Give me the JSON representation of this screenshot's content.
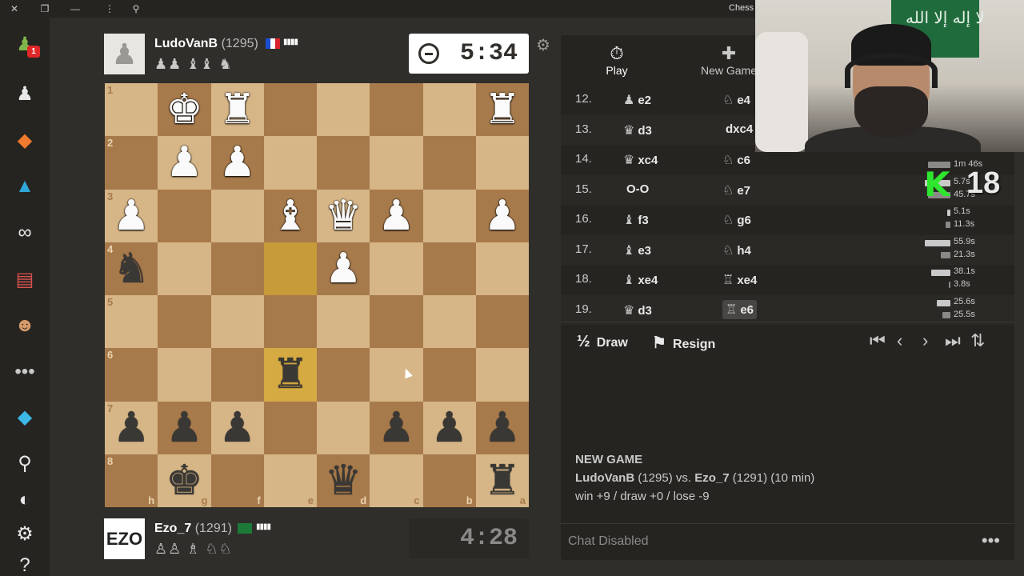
{
  "window": {
    "title": "Chess -"
  },
  "sidebar": {
    "notification_count": "1"
  },
  "top_player": {
    "name": "LudoVanB",
    "rating": "(1295)",
    "captured": "♟♟ ♝♝ ♞",
    "clock": "5:34"
  },
  "bottom_player": {
    "name": "Ezo_7",
    "rating": "(1291)",
    "avatar_text": "EZO",
    "captured": "♙♙ ♗ ♘♘",
    "clock": "4:28"
  },
  "board": {
    "rank_labels": [
      "1",
      "2",
      "3",
      "4",
      "5",
      "6",
      "7",
      "8"
    ],
    "file_labels": [
      "h",
      "g",
      "f",
      "e",
      "d",
      "c",
      "b",
      "a"
    ],
    "rows": [
      [
        "",
        "wK",
        "wR",
        "",
        "",
        "",
        "",
        "wR"
      ],
      [
        "",
        "wP",
        "wP",
        "",
        "",
        "",
        "",
        ""
      ],
      [
        "wP",
        "",
        "",
        "wB",
        "wQ",
        "wP",
        "",
        "wP"
      ],
      [
        "bN",
        "",
        "",
        "",
        "wP",
        "",
        "",
        ""
      ],
      [
        "",
        "",
        "",
        "",
        "",
        "",
        "",
        ""
      ],
      [
        "",
        "",
        "",
        "bR",
        "",
        "",
        "",
        ""
      ],
      [
        "bP",
        "bP",
        "bP",
        "",
        "",
        "bP",
        "bP",
        "bP"
      ],
      [
        "",
        "bK",
        "",
        "",
        "bQ",
        "",
        "",
        "bR"
      ]
    ]
  },
  "tabs": {
    "play": "Play",
    "new_game": "New Game"
  },
  "moves": [
    {
      "n": "12.",
      "wp": "♟",
      "w": "e2",
      "bp": "♘",
      "b": "e4",
      "wt": "",
      "bt": ""
    },
    {
      "n": "13.",
      "wp": "♛",
      "w": "d3",
      "bp": "",
      "b": "dxc4",
      "wt": "",
      "bt": ""
    },
    {
      "n": "14.",
      "wp": "♛",
      "w": "xc4",
      "bp": "♘",
      "b": "c6",
      "wt": "",
      "bt": "1m 46s"
    },
    {
      "n": "15.",
      "wp": "",
      "w": "O-O",
      "bp": "♘",
      "b": "e7",
      "wt": "5.7s",
      "bt": "45.7s"
    },
    {
      "n": "16.",
      "wp": "♝",
      "w": "f3",
      "bp": "♘",
      "b": "g6",
      "wt": "5.1s",
      "bt": "11.3s"
    },
    {
      "n": "17.",
      "wp": "♝",
      "w": "e3",
      "bp": "♘",
      "b": "h4",
      "wt": "55.9s",
      "bt": "21.3s"
    },
    {
      "n": "18.",
      "wp": "♝",
      "w": "xe4",
      "bp": "♖",
      "b": "xe4",
      "wt": "38.1s",
      "bt": "3.8s"
    },
    {
      "n": "19.",
      "wp": "♛",
      "w": "d3",
      "bp": "♖",
      "b": "e6",
      "wt": "25.6s",
      "bt": "25.5s"
    }
  ],
  "controls": {
    "draw_icon": "½",
    "draw": "Draw",
    "resign": "Resign"
  },
  "new_game_info": {
    "heading": "NEW GAME",
    "white": "LudoVanB",
    "white_rating": "(1295)",
    "vs": "vs.",
    "black": "Ezo_7",
    "black_rating": "(1291)",
    "time": "(10 min)",
    "stakes": "win +9 / draw +0 / lose -9"
  },
  "chat": {
    "status": "Chat Disabled"
  },
  "webcam": {
    "banner_text": "لا إله إلا الله"
  },
  "overlay": {
    "letter": "K",
    "number": "18"
  },
  "colors": {
    "light_square": "#d6b587",
    "dark_square": "#a77a4b",
    "highlight": "#d5aa42",
    "accent_green": "#81b64c"
  }
}
